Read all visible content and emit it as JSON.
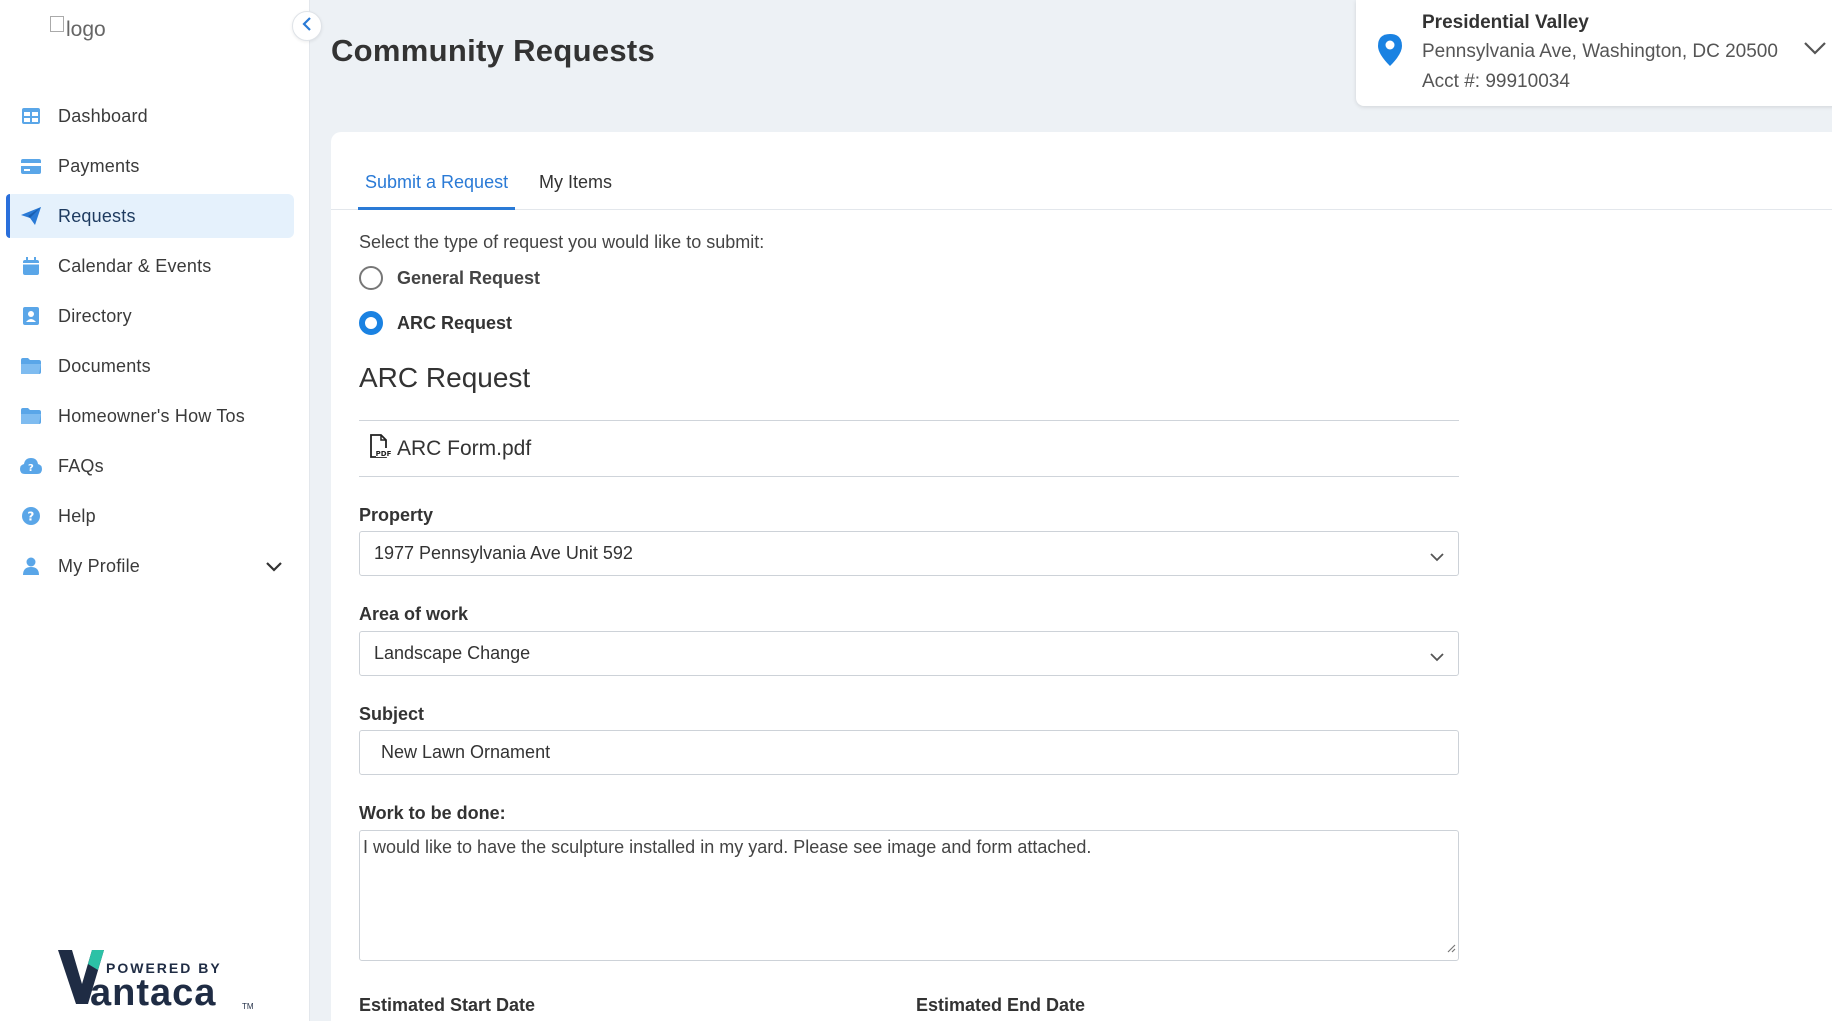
{
  "sidebar": {
    "logo_alt": "logo",
    "items": [
      {
        "label": "Dashboard",
        "icon": "dashboard-icon"
      },
      {
        "label": "Payments",
        "icon": "credit-card-icon"
      },
      {
        "label": "Requests",
        "icon": "paper-plane-icon",
        "active": true
      },
      {
        "label": "Calendar & Events",
        "icon": "calendar-icon"
      },
      {
        "label": "Directory",
        "icon": "contact-book-icon"
      },
      {
        "label": "Documents",
        "icon": "folder-icon"
      },
      {
        "label": "Homeowner's How Tos",
        "icon": "folder-icon"
      },
      {
        "label": "FAQs",
        "icon": "cloud-question-icon"
      },
      {
        "label": "Help",
        "icon": "help-circle-icon"
      },
      {
        "label": "My Profile",
        "icon": "user-icon"
      }
    ],
    "powered_by": "POWERED BY",
    "brand": "antaca",
    "brand_initial": "V",
    "trademark": "TM"
  },
  "header": {
    "title": "Community Requests",
    "location": {
      "name": "Presidential Valley",
      "address": "Pennsylvania Ave, Washington, DC 20500",
      "account": "Acct #: 99910034"
    }
  },
  "tabs": [
    {
      "label": "Submit a Request",
      "active": true
    },
    {
      "label": "My Items",
      "active": false
    }
  ],
  "form": {
    "prompt": "Select the type of request you would like to submit:",
    "options": [
      {
        "label": "General Request",
        "selected": false
      },
      {
        "label": "ARC Request",
        "selected": true
      }
    ],
    "section_title": "ARC Request",
    "attachment": "ARC Form.pdf",
    "property_label": "Property",
    "property_value": "1977 Pennsylvania Ave Unit 592",
    "area_label": "Area of work",
    "area_value": "Landscape Change",
    "subject_label": "Subject",
    "subject_value": "New Lawn Ornament",
    "work_label": "Work to be done:",
    "work_value": "I would like to have the sculpture installed in my yard. Please see image and form attached.",
    "start_label": "Estimated Start Date",
    "end_label": "Estimated End Date"
  },
  "colors": {
    "accent": "#2a7ad6",
    "active_bg": "#e5f1fc",
    "icon_blue": "#5aa6e8",
    "page_bg": "#edf1f5"
  }
}
